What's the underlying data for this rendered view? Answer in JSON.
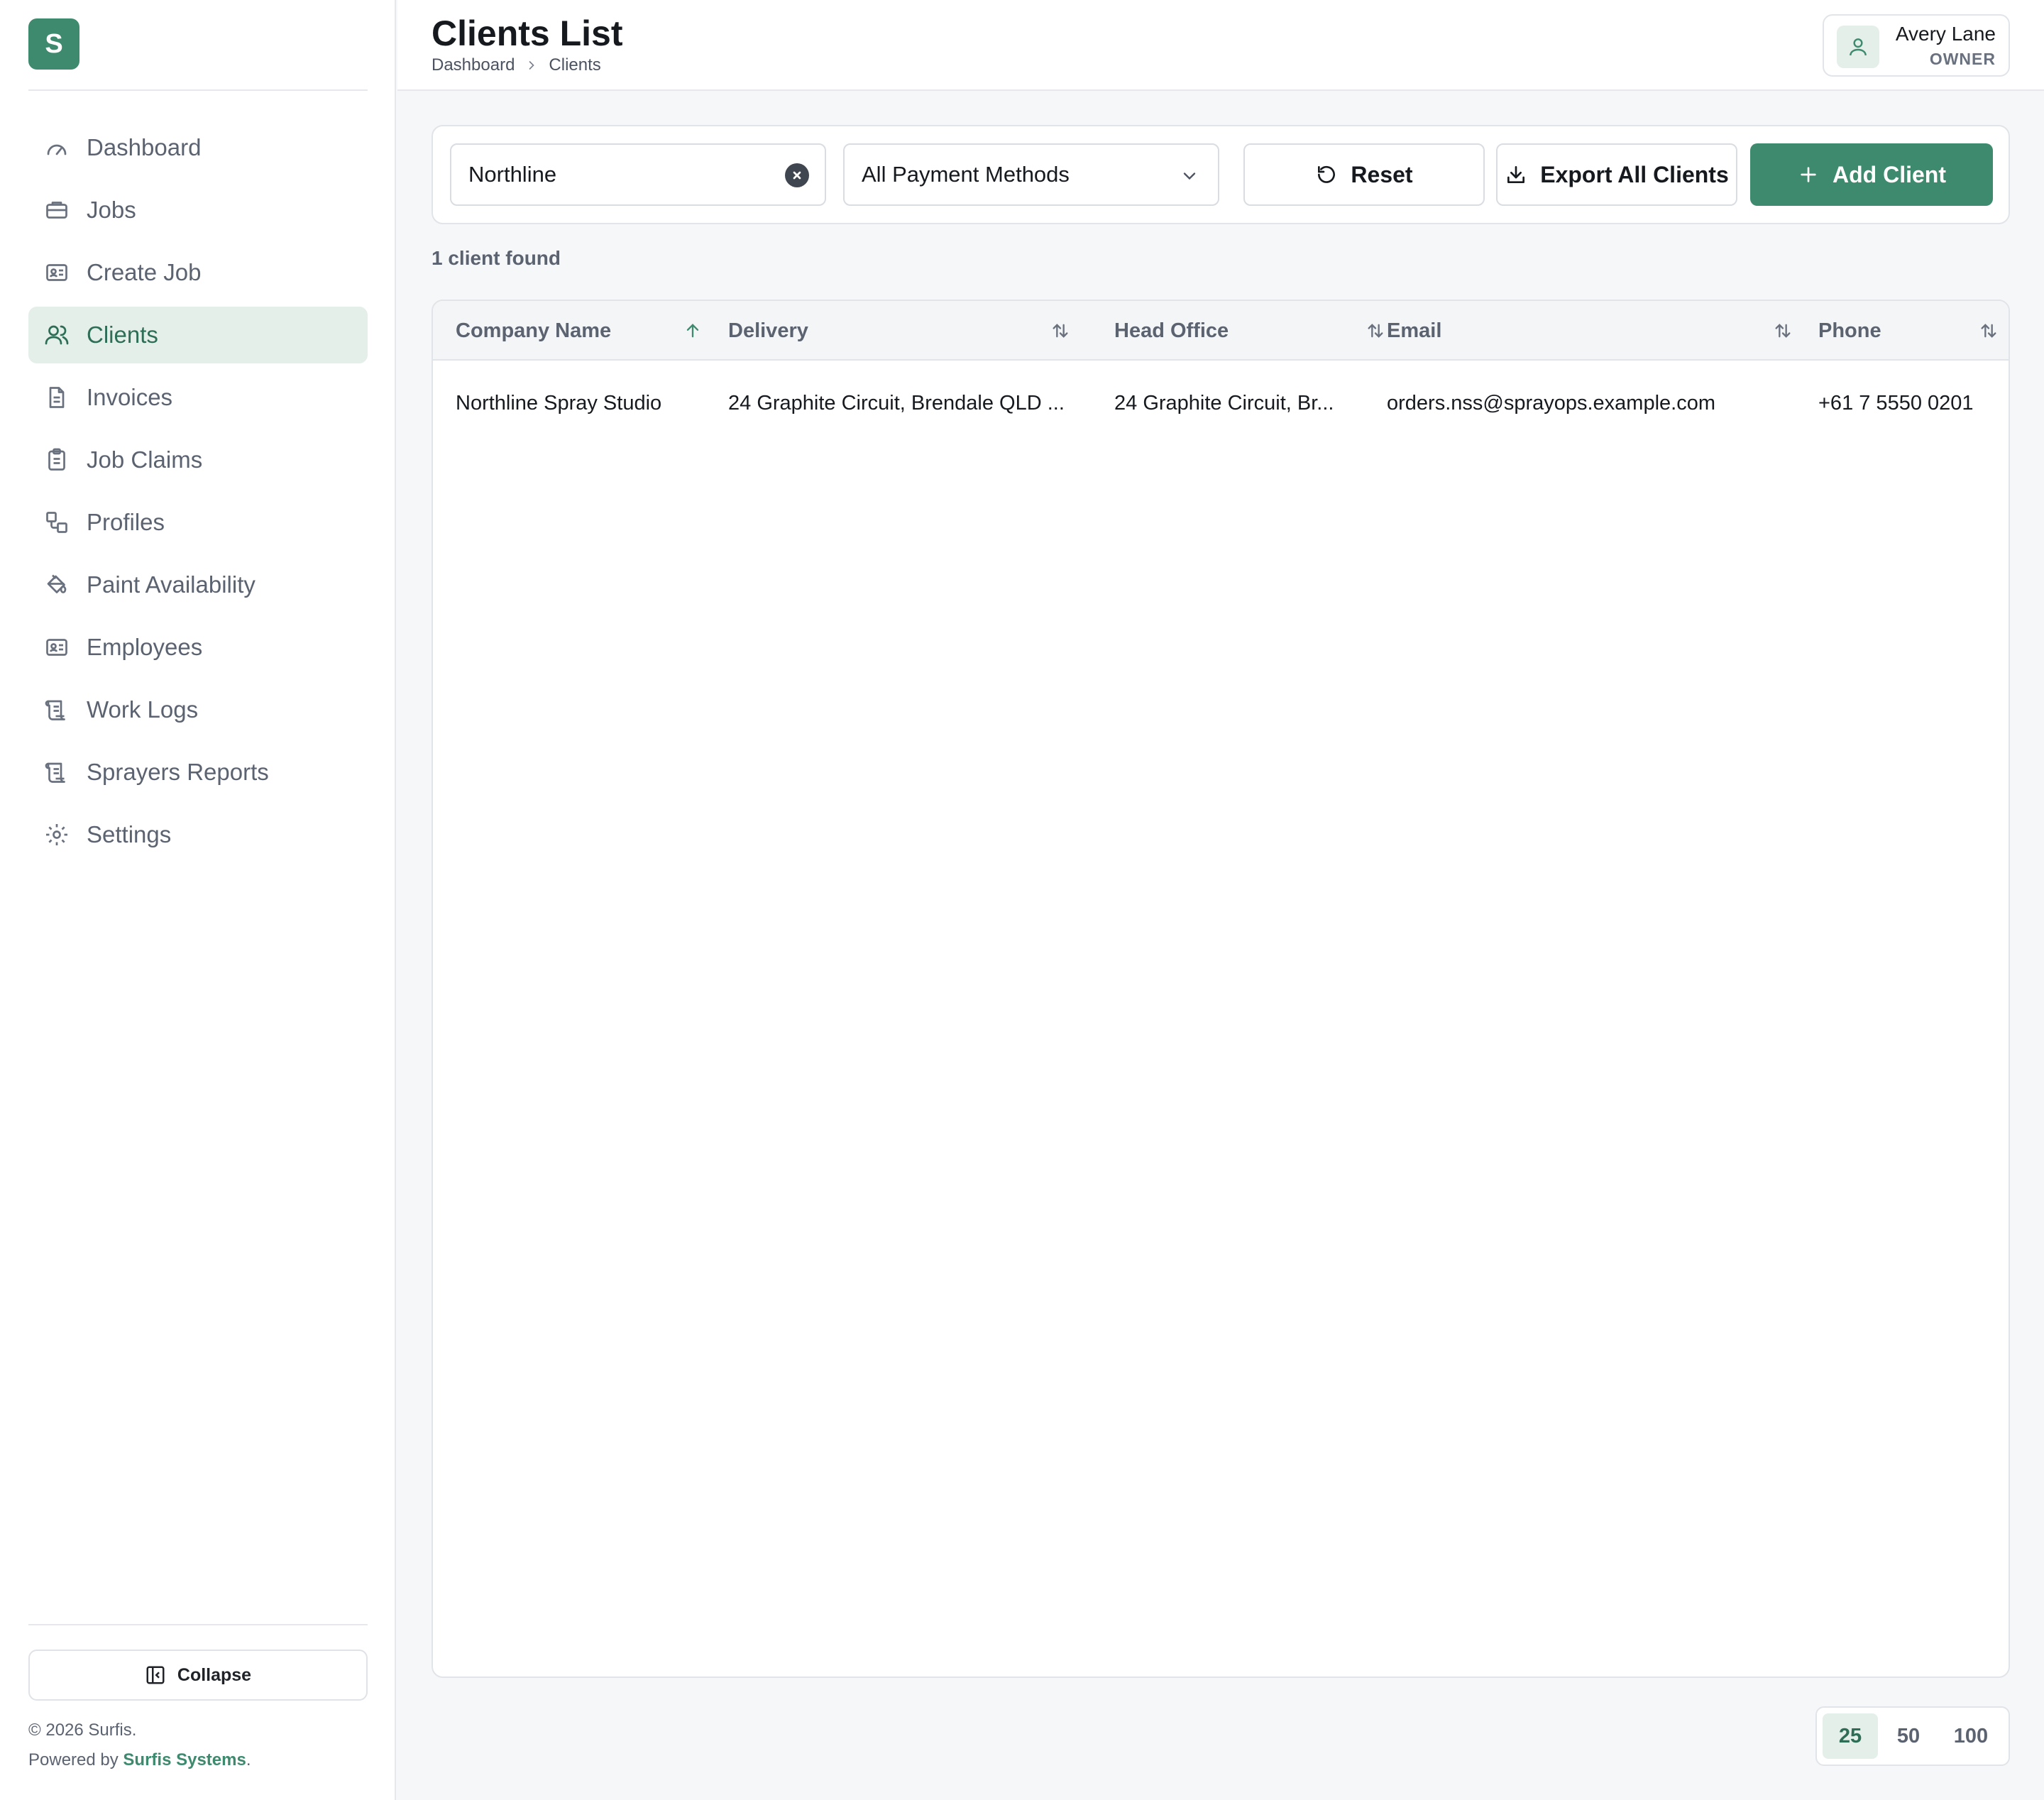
{
  "app": {
    "logo_letter": "S",
    "brand_color": "#3d8a6e"
  },
  "sidebar": {
    "items": [
      {
        "label": "Dashboard",
        "icon": "gauge-icon",
        "active": false
      },
      {
        "label": "Jobs",
        "icon": "briefcase-icon",
        "active": false
      },
      {
        "label": "Create Job",
        "icon": "id-card-icon",
        "active": false
      },
      {
        "label": "Clients",
        "icon": "users-icon",
        "active": true
      },
      {
        "label": "Invoices",
        "icon": "file-text-icon",
        "active": false
      },
      {
        "label": "Job Claims",
        "icon": "clipboard-icon",
        "active": false
      },
      {
        "label": "Profiles",
        "icon": "shapes-icon",
        "active": false
      },
      {
        "label": "Paint Availability",
        "icon": "paint-bucket-icon",
        "active": false
      },
      {
        "label": "Employees",
        "icon": "id-card-icon",
        "active": false
      },
      {
        "label": "Work Logs",
        "icon": "scroll-icon",
        "active": false
      },
      {
        "label": "Sprayers Reports",
        "icon": "scroll-icon",
        "active": false
      },
      {
        "label": "Settings",
        "icon": "gear-icon",
        "active": false
      }
    ],
    "collapse_label": "Collapse",
    "copyright": "© 2026 Surfis.",
    "powered_prefix": "Powered by ",
    "powered_brand": "Surfis Systems",
    "powered_suffix": "."
  },
  "header": {
    "title": "Clients List",
    "breadcrumb": [
      "Dashboard",
      "Clients"
    ],
    "user": {
      "name": "Avery Lane",
      "role": "OWNER"
    }
  },
  "filters": {
    "search_value": "Northline",
    "payment_method": "All Payment Methods",
    "reset_label": "Reset",
    "export_label": "Export All Clients",
    "add_label": "Add Client"
  },
  "results": {
    "count_text": "1 client found"
  },
  "table": {
    "columns": [
      {
        "label": "Company Name",
        "sort": "asc"
      },
      {
        "label": "Delivery",
        "sort": "none"
      },
      {
        "label": "Head Office",
        "sort": "none"
      },
      {
        "label": "Email",
        "sort": "none"
      },
      {
        "label": "Phone",
        "sort": "none"
      }
    ],
    "rows": [
      {
        "company": "Northline Spray Studio",
        "delivery": "24 Graphite Circuit, Brendale QLD ...",
        "head_office": "24 Graphite Circuit, Br...",
        "email": "orders.nss@sprayops.example.com",
        "phone": "+61 7 5550 0201"
      }
    ]
  },
  "pagination": {
    "sizes": [
      "25",
      "50",
      "100"
    ],
    "selected": "25"
  }
}
